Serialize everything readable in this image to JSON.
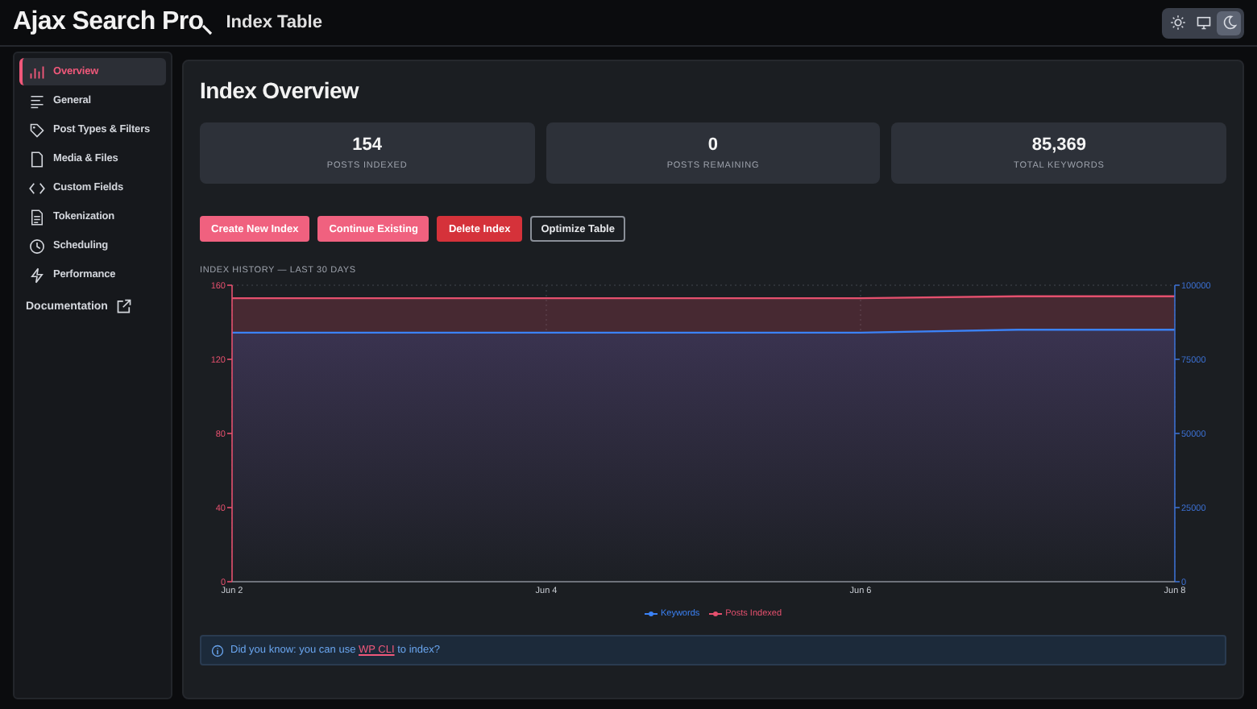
{
  "header": {
    "logo": "Ajax Search Pro",
    "title": "Index Table",
    "theme_switch": [
      {
        "selected": false
      },
      {
        "selected": false
      },
      {
        "selected": true
      }
    ]
  },
  "sidebar": {
    "items": [
      {
        "label": "Overview",
        "selected": true
      },
      {
        "label": "General",
        "selected": false
      },
      {
        "label": "Post Types & Filters",
        "selected": false
      },
      {
        "label": "Media & Files",
        "selected": false
      },
      {
        "label": "Custom Fields",
        "selected": false
      },
      {
        "label": "Tokenization",
        "selected": false
      },
      {
        "label": "Scheduling",
        "selected": false
      },
      {
        "label": "Performance",
        "selected": false
      }
    ],
    "documentation_link": "Documentation"
  },
  "main": {
    "title": "Index Overview",
    "stats": [
      {
        "value": "154",
        "label": "POSTS INDEXED"
      },
      {
        "value": "0",
        "label": "POSTS REMAINING"
      },
      {
        "value": "85,369",
        "label": "TOTAL KEYWORDS"
      }
    ],
    "buttons": [
      {
        "label": "Create New Index",
        "kind": "primary"
      },
      {
        "label": "Continue Existing",
        "kind": "primary"
      },
      {
        "label": "Delete Index",
        "kind": "danger"
      },
      {
        "label": "Optimize Table",
        "kind": "outline"
      }
    ],
    "chart_title": "INDEX HISTORY — LAST 30 DAYS",
    "chart_data": {
      "type": "area",
      "legend": "bottom",
      "categories": [
        "Jun 2",
        null,
        "Jun 4",
        null,
        "Jun 6",
        null,
        "Jun 8"
      ],
      "ylim": [
        0,
        160
      ],
      "yticks": [
        0,
        40,
        80,
        120,
        160
      ],
      "y2lim": [
        0,
        100000
      ],
      "y2ticks": [
        0,
        25000,
        50000,
        75000,
        100000
      ],
      "series": [
        {
          "name": "Keywords",
          "color": "#3b82f6",
          "axis": "y2",
          "values": [
            84000,
            84000,
            84000,
            84000,
            84000,
            85000,
            85000
          ]
        },
        {
          "name": "Posts Indexed",
          "color": "#e5506e",
          "values": [
            153,
            153,
            153,
            153,
            153,
            154,
            154
          ]
        }
      ]
    },
    "tip": {
      "before": "Did you know: you can use ",
      "link": "WP CLI",
      "after": " to index?"
    }
  }
}
